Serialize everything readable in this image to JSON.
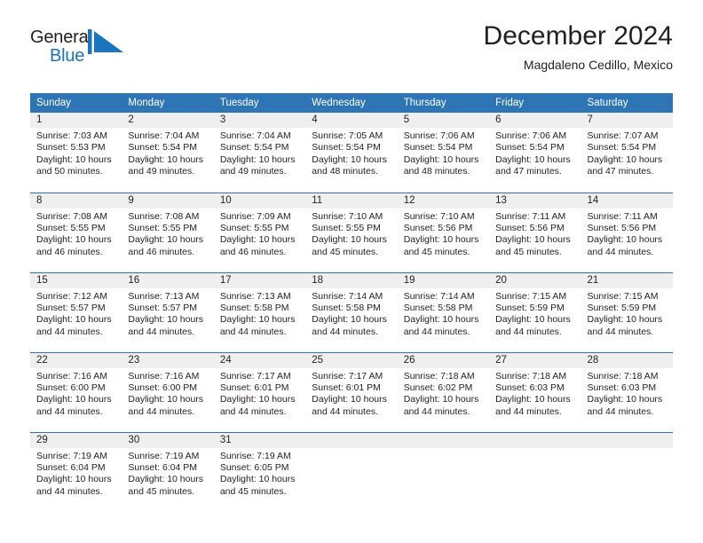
{
  "brand": {
    "name_part1": "General",
    "name_part2": "Blue",
    "mark": "triangle-flag-icon",
    "accent_color": "#1b75bc"
  },
  "header": {
    "title": "December 2024",
    "subtitle": "Magdaleno Cedillo, Mexico"
  },
  "theme": {
    "header_blue": "#2e75b6",
    "daynum_band": "#efefef",
    "text": "#231f20"
  },
  "calendar": {
    "weekday_headers": [
      "Sunday",
      "Monday",
      "Tuesday",
      "Wednesday",
      "Thursday",
      "Friday",
      "Saturday"
    ],
    "weeks": [
      [
        {
          "day": "1",
          "sunrise": "Sunrise: 7:03 AM",
          "sunset": "Sunset: 5:53 PM",
          "daylight_line1": "Daylight: 10 hours",
          "daylight_line2": "and 50 minutes."
        },
        {
          "day": "2",
          "sunrise": "Sunrise: 7:04 AM",
          "sunset": "Sunset: 5:54 PM",
          "daylight_line1": "Daylight: 10 hours",
          "daylight_line2": "and 49 minutes."
        },
        {
          "day": "3",
          "sunrise": "Sunrise: 7:04 AM",
          "sunset": "Sunset: 5:54 PM",
          "daylight_line1": "Daylight: 10 hours",
          "daylight_line2": "and 49 minutes."
        },
        {
          "day": "4",
          "sunrise": "Sunrise: 7:05 AM",
          "sunset": "Sunset: 5:54 PM",
          "daylight_line1": "Daylight: 10 hours",
          "daylight_line2": "and 48 minutes."
        },
        {
          "day": "5",
          "sunrise": "Sunrise: 7:06 AM",
          "sunset": "Sunset: 5:54 PM",
          "daylight_line1": "Daylight: 10 hours",
          "daylight_line2": "and 48 minutes."
        },
        {
          "day": "6",
          "sunrise": "Sunrise: 7:06 AM",
          "sunset": "Sunset: 5:54 PM",
          "daylight_line1": "Daylight: 10 hours",
          "daylight_line2": "and 47 minutes."
        },
        {
          "day": "7",
          "sunrise": "Sunrise: 7:07 AM",
          "sunset": "Sunset: 5:54 PM",
          "daylight_line1": "Daylight: 10 hours",
          "daylight_line2": "and 47 minutes."
        }
      ],
      [
        {
          "day": "8",
          "sunrise": "Sunrise: 7:08 AM",
          "sunset": "Sunset: 5:55 PM",
          "daylight_line1": "Daylight: 10 hours",
          "daylight_line2": "and 46 minutes."
        },
        {
          "day": "9",
          "sunrise": "Sunrise: 7:08 AM",
          "sunset": "Sunset: 5:55 PM",
          "daylight_line1": "Daylight: 10 hours",
          "daylight_line2": "and 46 minutes."
        },
        {
          "day": "10",
          "sunrise": "Sunrise: 7:09 AM",
          "sunset": "Sunset: 5:55 PM",
          "daylight_line1": "Daylight: 10 hours",
          "daylight_line2": "and 46 minutes."
        },
        {
          "day": "11",
          "sunrise": "Sunrise: 7:10 AM",
          "sunset": "Sunset: 5:55 PM",
          "daylight_line1": "Daylight: 10 hours",
          "daylight_line2": "and 45 minutes."
        },
        {
          "day": "12",
          "sunrise": "Sunrise: 7:10 AM",
          "sunset": "Sunset: 5:56 PM",
          "daylight_line1": "Daylight: 10 hours",
          "daylight_line2": "and 45 minutes."
        },
        {
          "day": "13",
          "sunrise": "Sunrise: 7:11 AM",
          "sunset": "Sunset: 5:56 PM",
          "daylight_line1": "Daylight: 10 hours",
          "daylight_line2": "and 45 minutes."
        },
        {
          "day": "14",
          "sunrise": "Sunrise: 7:11 AM",
          "sunset": "Sunset: 5:56 PM",
          "daylight_line1": "Daylight: 10 hours",
          "daylight_line2": "and 44 minutes."
        }
      ],
      [
        {
          "day": "15",
          "sunrise": "Sunrise: 7:12 AM",
          "sunset": "Sunset: 5:57 PM",
          "daylight_line1": "Daylight: 10 hours",
          "daylight_line2": "and 44 minutes."
        },
        {
          "day": "16",
          "sunrise": "Sunrise: 7:13 AM",
          "sunset": "Sunset: 5:57 PM",
          "daylight_line1": "Daylight: 10 hours",
          "daylight_line2": "and 44 minutes."
        },
        {
          "day": "17",
          "sunrise": "Sunrise: 7:13 AM",
          "sunset": "Sunset: 5:58 PM",
          "daylight_line1": "Daylight: 10 hours",
          "daylight_line2": "and 44 minutes."
        },
        {
          "day": "18",
          "sunrise": "Sunrise: 7:14 AM",
          "sunset": "Sunset: 5:58 PM",
          "daylight_line1": "Daylight: 10 hours",
          "daylight_line2": "and 44 minutes."
        },
        {
          "day": "19",
          "sunrise": "Sunrise: 7:14 AM",
          "sunset": "Sunset: 5:58 PM",
          "daylight_line1": "Daylight: 10 hours",
          "daylight_line2": "and 44 minutes."
        },
        {
          "day": "20",
          "sunrise": "Sunrise: 7:15 AM",
          "sunset": "Sunset: 5:59 PM",
          "daylight_line1": "Daylight: 10 hours",
          "daylight_line2": "and 44 minutes."
        },
        {
          "day": "21",
          "sunrise": "Sunrise: 7:15 AM",
          "sunset": "Sunset: 5:59 PM",
          "daylight_line1": "Daylight: 10 hours",
          "daylight_line2": "and 44 minutes."
        }
      ],
      [
        {
          "day": "22",
          "sunrise": "Sunrise: 7:16 AM",
          "sunset": "Sunset: 6:00 PM",
          "daylight_line1": "Daylight: 10 hours",
          "daylight_line2": "and 44 minutes."
        },
        {
          "day": "23",
          "sunrise": "Sunrise: 7:16 AM",
          "sunset": "Sunset: 6:00 PM",
          "daylight_line1": "Daylight: 10 hours",
          "daylight_line2": "and 44 minutes."
        },
        {
          "day": "24",
          "sunrise": "Sunrise: 7:17 AM",
          "sunset": "Sunset: 6:01 PM",
          "daylight_line1": "Daylight: 10 hours",
          "daylight_line2": "and 44 minutes."
        },
        {
          "day": "25",
          "sunrise": "Sunrise: 7:17 AM",
          "sunset": "Sunset: 6:01 PM",
          "daylight_line1": "Daylight: 10 hours",
          "daylight_line2": "and 44 minutes."
        },
        {
          "day": "26",
          "sunrise": "Sunrise: 7:18 AM",
          "sunset": "Sunset: 6:02 PM",
          "daylight_line1": "Daylight: 10 hours",
          "daylight_line2": "and 44 minutes."
        },
        {
          "day": "27",
          "sunrise": "Sunrise: 7:18 AM",
          "sunset": "Sunset: 6:03 PM",
          "daylight_line1": "Daylight: 10 hours",
          "daylight_line2": "and 44 minutes."
        },
        {
          "day": "28",
          "sunrise": "Sunrise: 7:18 AM",
          "sunset": "Sunset: 6:03 PM",
          "daylight_line1": "Daylight: 10 hours",
          "daylight_line2": "and 44 minutes."
        }
      ],
      [
        {
          "day": "29",
          "sunrise": "Sunrise: 7:19 AM",
          "sunset": "Sunset: 6:04 PM",
          "daylight_line1": "Daylight: 10 hours",
          "daylight_line2": "and 44 minutes."
        },
        {
          "day": "30",
          "sunrise": "Sunrise: 7:19 AM",
          "sunset": "Sunset: 6:04 PM",
          "daylight_line1": "Daylight: 10 hours",
          "daylight_line2": "and 45 minutes."
        },
        {
          "day": "31",
          "sunrise": "Sunrise: 7:19 AM",
          "sunset": "Sunset: 6:05 PM",
          "daylight_line1": "Daylight: 10 hours",
          "daylight_line2": "and 45 minutes."
        },
        {
          "day": "",
          "sunrise": "",
          "sunset": "",
          "daylight_line1": "",
          "daylight_line2": ""
        },
        {
          "day": "",
          "sunrise": "",
          "sunset": "",
          "daylight_line1": "",
          "daylight_line2": ""
        },
        {
          "day": "",
          "sunrise": "",
          "sunset": "",
          "daylight_line1": "",
          "daylight_line2": ""
        },
        {
          "day": "",
          "sunrise": "",
          "sunset": "",
          "daylight_line1": "",
          "daylight_line2": ""
        }
      ]
    ]
  }
}
